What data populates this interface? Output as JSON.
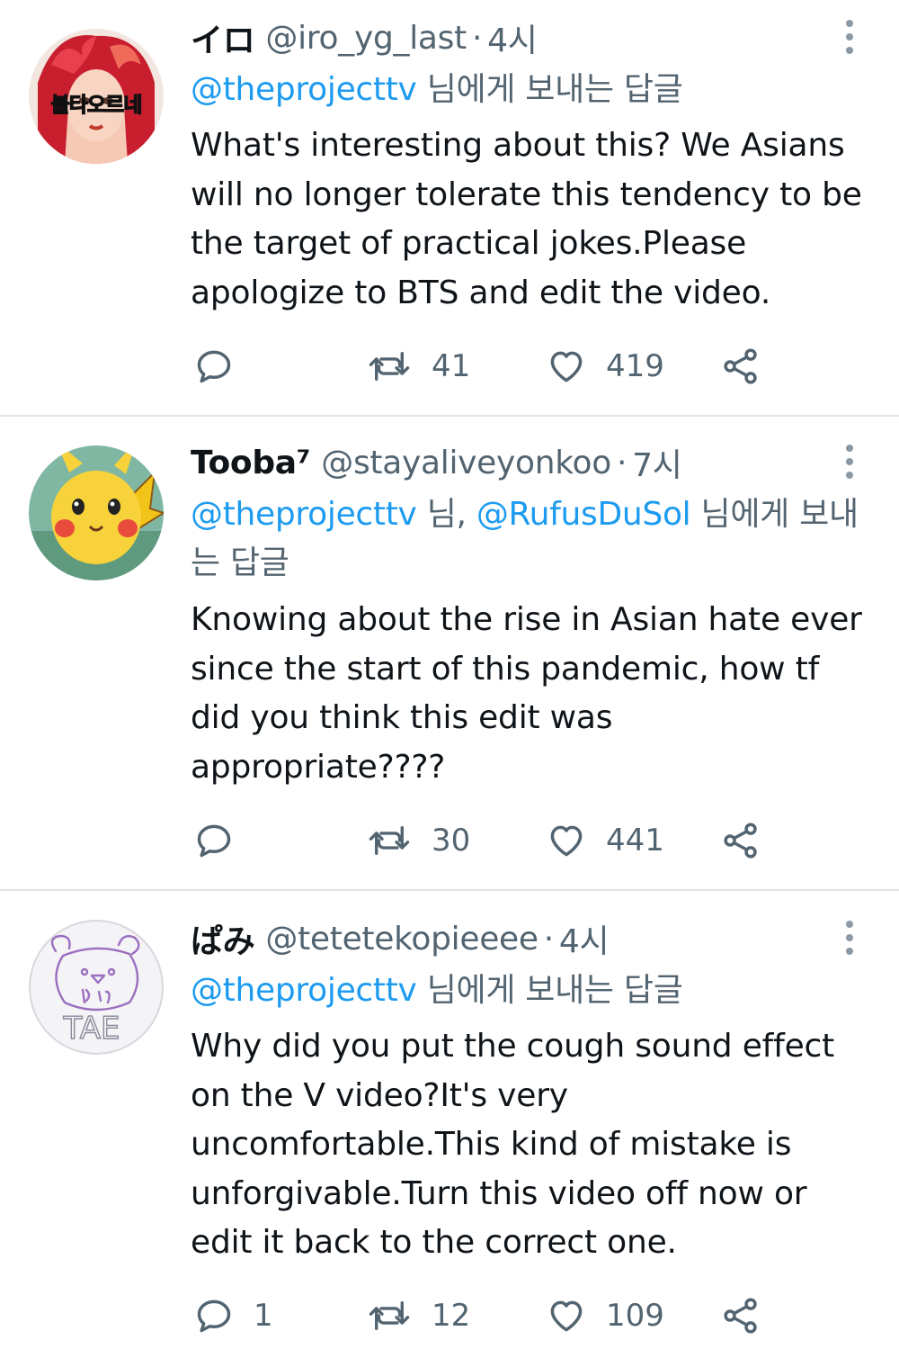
{
  "tweets": [
    {
      "display_name": "イロ",
      "handle": "@iro_yg_last",
      "time": "4시",
      "avatar_text": "불타오르네",
      "replying": [
        {
          "text": "@theprojecttv",
          "mention": true
        },
        {
          "text": " 님에게 보내는 답글",
          "mention": false
        }
      ],
      "text": "What's interesting about this? We Asians will no longer tolerate this tendency to be the target of practical jokes.Please apologize to BTS and edit the video.",
      "replies": "",
      "retweets": "41",
      "likes": "419"
    },
    {
      "display_name": "Tooba⁷",
      "handle": "@stayaliveyonkoo",
      "time": "7시",
      "avatar_text": "",
      "replying": [
        {
          "text": "@theprojecttv",
          "mention": true
        },
        {
          "text": " 님, ",
          "mention": false
        },
        {
          "text": "@RufusDuSol",
          "mention": true
        },
        {
          "text": " 님에게 보내는 답글",
          "mention": false
        }
      ],
      "text": "Knowing about the rise in Asian hate ever since the start of this pandemic, how tf did you think this edit was appropriate????",
      "replies": "",
      "retweets": "30",
      "likes": "441"
    },
    {
      "display_name": "ぱみ",
      "handle": "@tetetekopieeee",
      "time": "4시",
      "avatar_text": "TAE",
      "replying": [
        {
          "text": "@theprojecttv",
          "mention": true
        },
        {
          "text": " 님에게 보내는 답글",
          "mention": false
        }
      ],
      "text": "Why did you put the cough sound effect on the V video?It's very uncomfortable.This kind of mistake is unforgivable.Turn this video off now or edit it back to the correct one.",
      "replies": "1",
      "retweets": "12",
      "likes": "109"
    }
  ],
  "icons": {
    "reply": "reply-icon",
    "retweet": "retweet-icon",
    "like": "heart-icon",
    "share": "share-icon",
    "more": "more-options-icon"
  },
  "colors": {
    "link": "#1d9bf0",
    "secondary": "#536471",
    "text": "#0f1419",
    "divider": "#e1e4e8"
  }
}
